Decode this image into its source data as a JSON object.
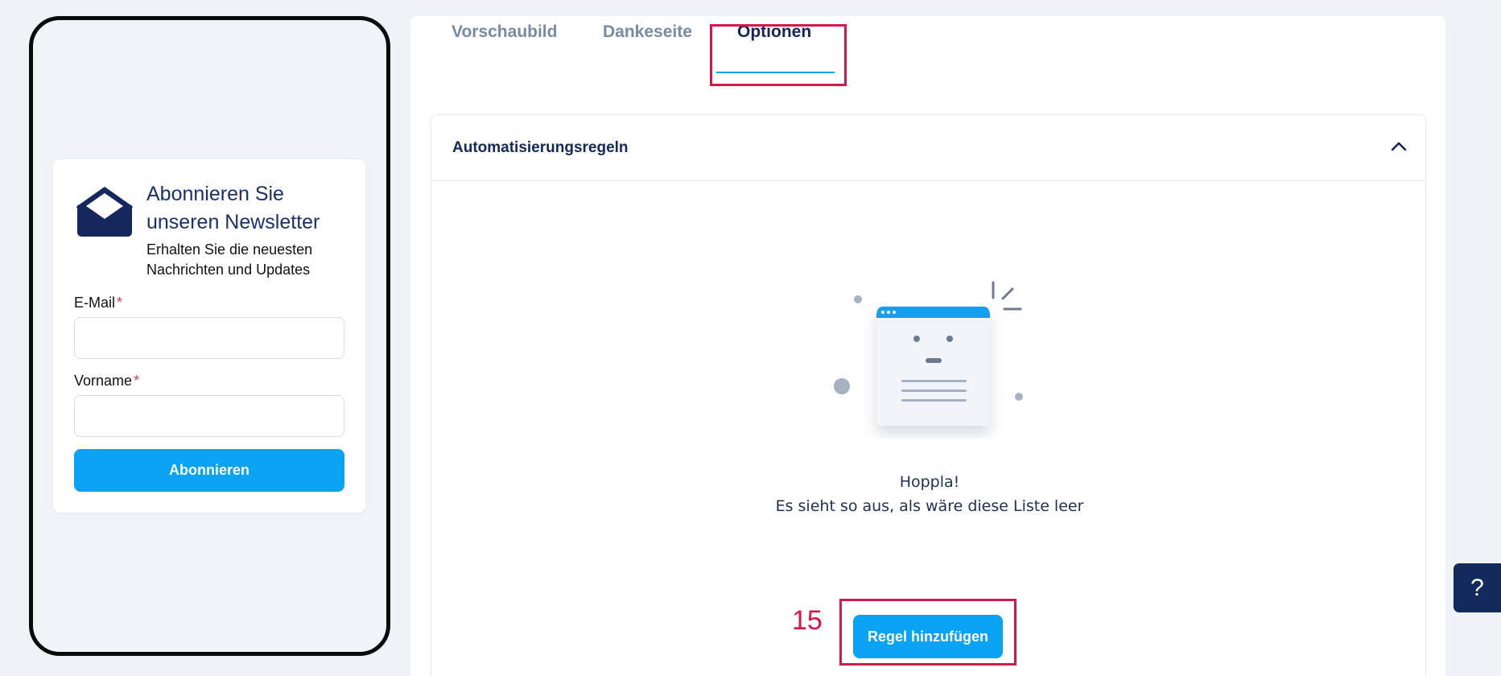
{
  "preview": {
    "icon": "envelope-open-icon",
    "title": "Abonnieren Sie unseren Newsletter",
    "subtitle": "Erhalten Sie die neuesten Nachrichten und Updates",
    "fields": [
      {
        "label": "E-Mail",
        "required_mark": "*",
        "value": ""
      },
      {
        "label": "Vorname",
        "required_mark": "*",
        "value": ""
      }
    ],
    "submit_label": "Abonnieren"
  },
  "tabs": [
    {
      "label": "Vorschaubild",
      "active": false
    },
    {
      "label": "Dankeseite",
      "active": false
    },
    {
      "label": "Optionen",
      "active": true
    }
  ],
  "section": {
    "title": "Automatisierungsregeln",
    "toggle_icon": "chevron-up-icon",
    "expanded": true
  },
  "empty_state": {
    "illustration": "empty-list-illustration",
    "title": "Hoppla!",
    "description": "Es sieht so aus, als wäre diese Liste leer"
  },
  "step_annotation": "15",
  "add_rule_label": "Regel hinzufügen",
  "help_label": "?",
  "colors": {
    "accent": "#0aa3f4",
    "navy": "#15285e",
    "highlight": "#d4184a",
    "required": "#e8345b",
    "background": "#eff2f7"
  }
}
